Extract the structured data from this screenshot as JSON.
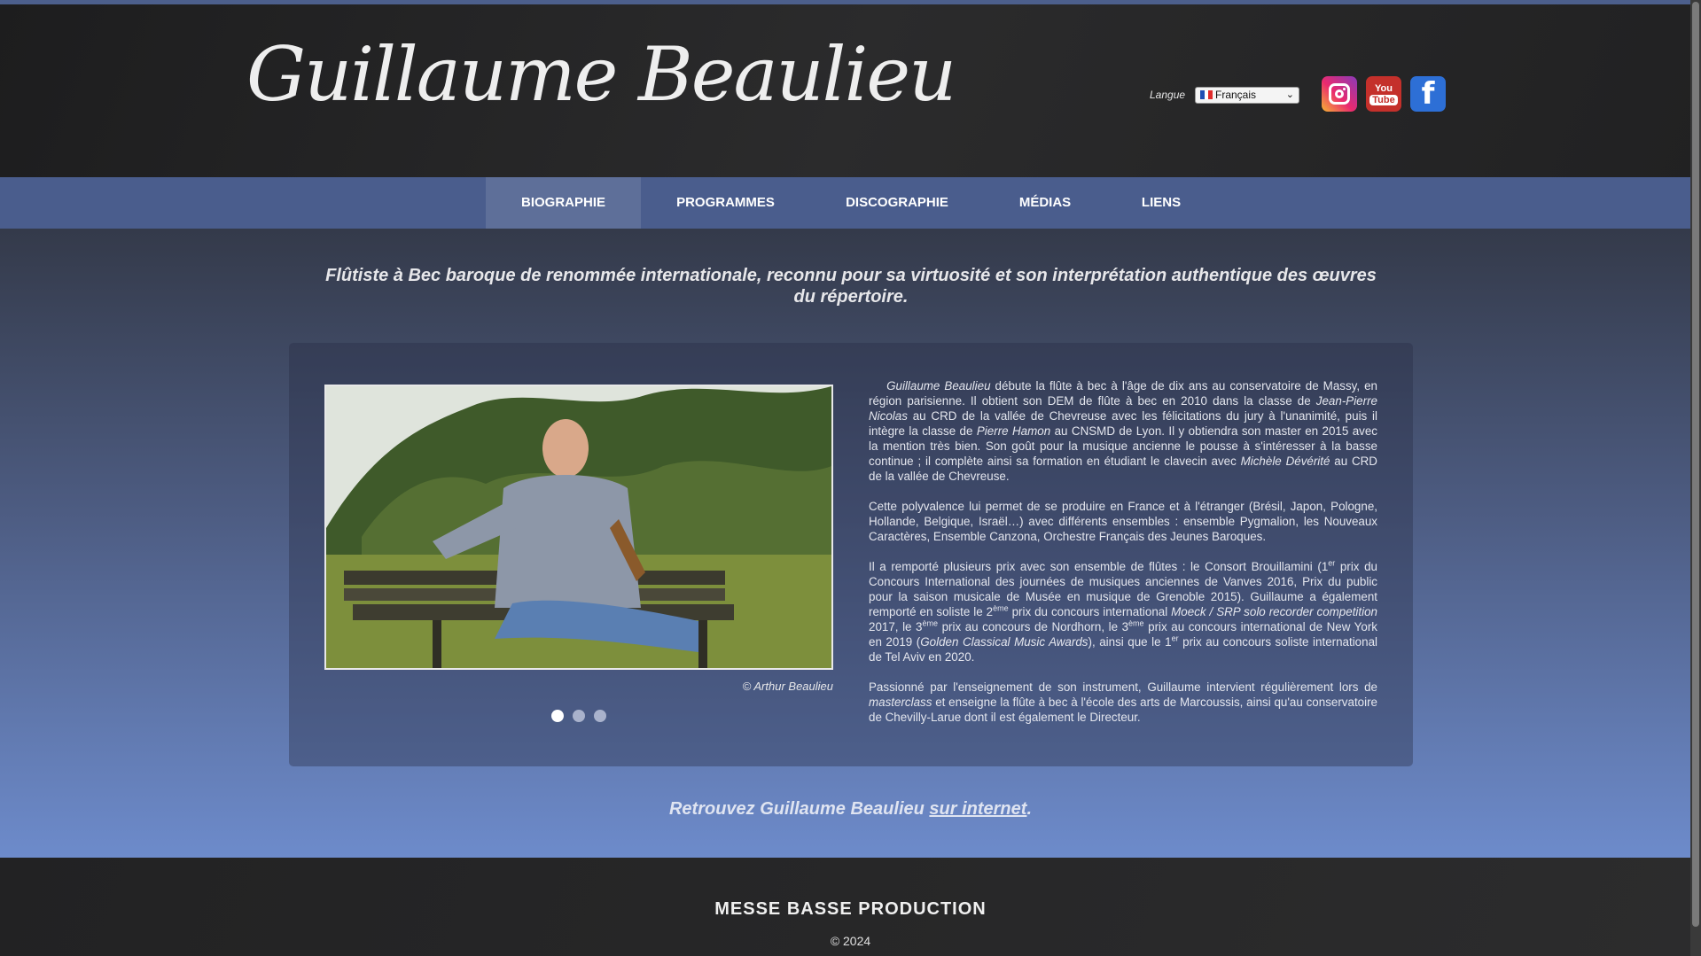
{
  "header": {
    "title": "Guillaume Beaulieu",
    "language_label": "Langue",
    "language_selected": "Français",
    "social": [
      "instagram-icon",
      "youtube-icon",
      "facebook-icon"
    ],
    "youtube_text_top": "You",
    "youtube_text_bottom": "Tube",
    "facebook_glyph": "f"
  },
  "nav": {
    "items": [
      "BIOGRAPHIE",
      "PROGRAMMES",
      "DISCOGRAPHIE",
      "MÉDIAS",
      "LIENS"
    ],
    "active": "BIOGRAPHIE"
  },
  "main": {
    "tagline": "Flûtiste à Bec baroque de renommée internationale, reconnu pour sa virtuosité et son interprétation authentique des œuvres du répertoire.",
    "photo_caption": "© Arthur Beaulieu",
    "slides": {
      "count": 3,
      "active": 1
    },
    "bio": {
      "p1": {
        "a": "Guillaume Beaulieu",
        "b": " débute la flûte à bec à l'âge de dix ans au conservatoire de Massy, en région parisienne. Il obtient son DEM de flûte à bec en 2010 dans la classe de ",
        "c": "Jean-Pierre Nicolas",
        "d": " au CRD de la vallée de Chevreuse avec les félicitations du jury à l'unanimité, puis il intègre la classe de ",
        "e": "Pierre Hamon",
        "f": " au CNSMD de Lyon. Il y obtiendra son master en 2015 avec la mention très bien. Son goût pour la musique ancienne le pousse à s'intéresser à la basse continue ; il complète ainsi sa formation en étudiant le clavecin avec ",
        "g": "Michèle Dévérité",
        "h": " au CRD de la vallée de Chevreuse."
      },
      "p2": "Cette polyvalence lui permet de se produire en France et à l'étranger (Brésil, Japon, Pologne, Hollande, Belgique, Israël…) avec différents ensembles : ensemble Pygmalion, les Nouveaux Caractères, Ensemble Canzona, Orchestre Français des Jeunes Baroques.",
      "p3": {
        "a": "Il a remporté plusieurs prix avec son ensemble de flûtes : le Consort Brouillamini (1",
        "a_sup": "er",
        "b": " prix du Concours International des journées de musiques anciennes de Vanves 2016, Prix du public pour la saison musicale de Musée en musique de Grenoble 2015). Guillaume a également remporté en soliste le 2",
        "b_sup": "ème",
        "c": " prix du concours international ",
        "d": "Moeck / SRP solo recorder competition",
        "e": " 2017, le 3",
        "e_sup": "ème",
        "f": " prix au concours de Nordhorn, le 3",
        "f_sup": "ème",
        "g": " prix au concours international de New York en 2019 (",
        "h": "Golden Classical Music Awards",
        "i": "), ainsi que le 1",
        "i_sup": "er",
        "j": " prix au concours soliste international de Tel Aviv en 2020."
      },
      "p4": {
        "a": "Passionné par l'enseignement de son instrument, Guillaume intervient régulièrement lors de ",
        "b": "masterclass",
        "c": " et enseigne la flûte à bec à l'école des arts de Marcoussis, ainsi qu'au conservatoire de Chevilly-Larue dont il est également le Directeur."
      }
    },
    "find_prefix": "Retrouvez Guillaume Beaulieu ",
    "find_link": "sur internet",
    "find_suffix": "."
  },
  "footer": {
    "title": "MESSE BASSE PRODUCTION",
    "copyright": "© 2024"
  },
  "colors": {
    "nav_bg": "#4a5d8d",
    "nav_active": "#5e6f99",
    "header_bg": "#252526",
    "footer_bg": "#2a2a2b"
  }
}
